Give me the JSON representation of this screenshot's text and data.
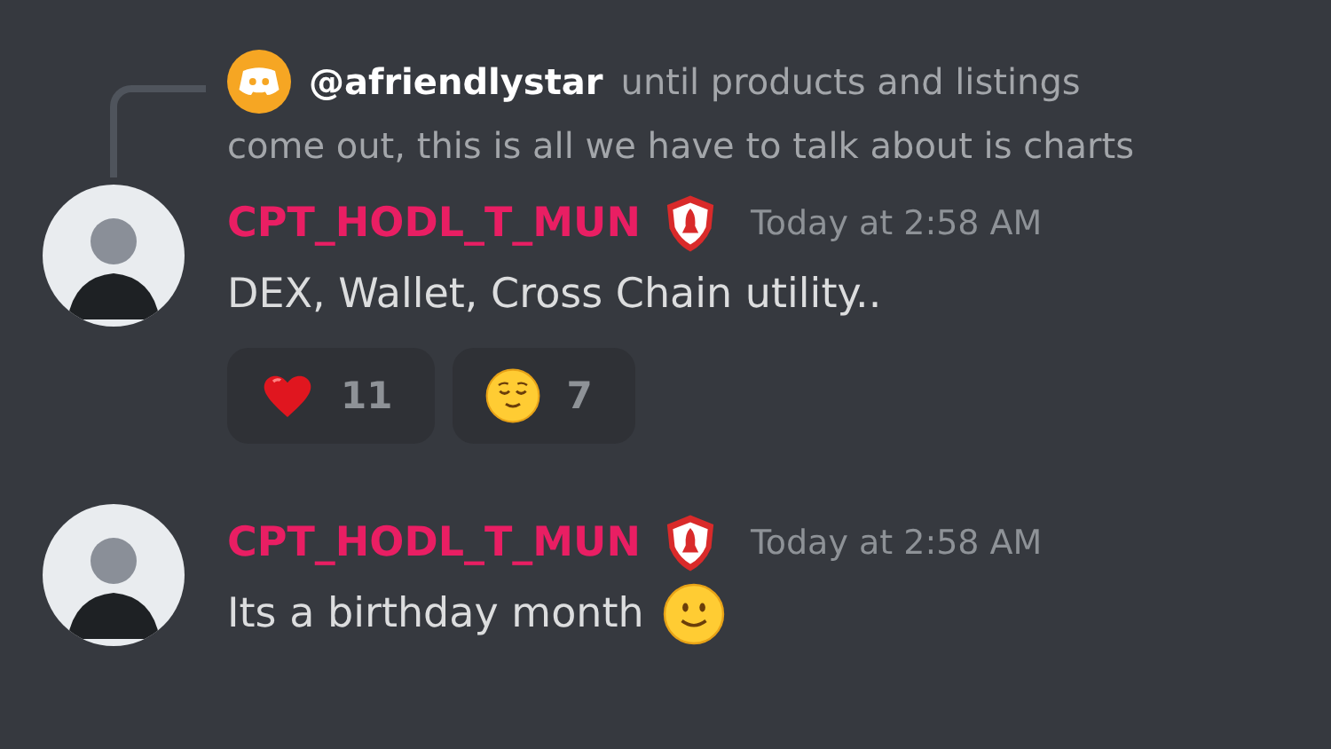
{
  "messages": [
    {
      "reply": {
        "username": "@afriendlystar",
        "lines": [
          "until products and listings",
          "come out, this is all we have to talk about is charts"
        ]
      },
      "author": "CPT_HODL_T_MUN",
      "timestamp": "Today at 2:58 AM",
      "text": "DEX, Wallet, Cross Chain utility..",
      "reactions": [
        {
          "kind": "heart",
          "count": "11"
        },
        {
          "kind": "relieved",
          "count": "7"
        }
      ]
    },
    {
      "author": "CPT_HODL_T_MUN",
      "timestamp": "Today at 2:58 AM",
      "text": "Its a birthday month",
      "emoji": {
        "kind": "slight-smile"
      }
    }
  ]
}
